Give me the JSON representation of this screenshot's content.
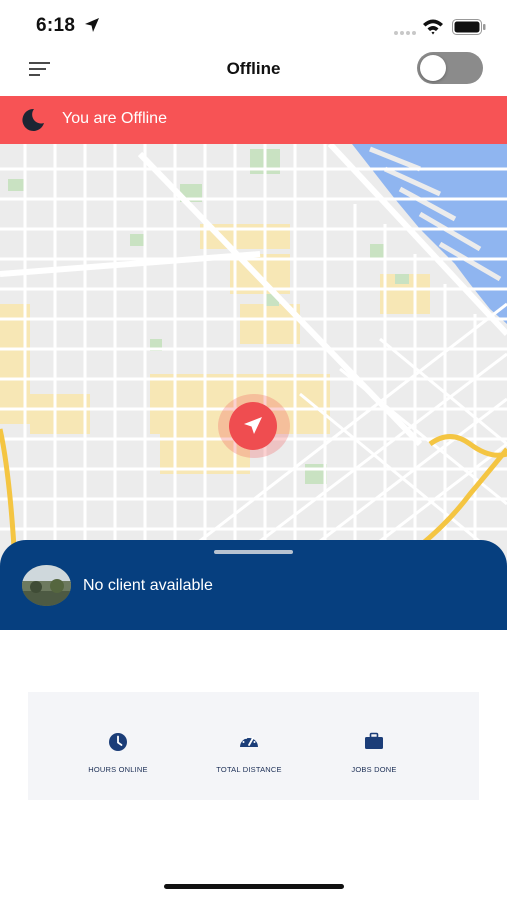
{
  "status_bar": {
    "time": "6:18"
  },
  "header": {
    "title": "Offline",
    "toggle_state": "off"
  },
  "banner": {
    "text": "You are Offline",
    "color": "#f75355"
  },
  "client_sheet": {
    "text": "No client available",
    "color": "#063f7f"
  },
  "stats": {
    "items": [
      {
        "label": "HOURS ONLINE",
        "icon": "clock-icon"
      },
      {
        "label": "TOTAL DISTANCE",
        "icon": "speedometer-icon"
      },
      {
        "label": "JOBS DONE",
        "icon": "briefcase-icon"
      }
    ]
  },
  "colors": {
    "accent_navy": "#063f7f",
    "offline_red": "#f75355",
    "marker_red": "#ef4d50"
  }
}
